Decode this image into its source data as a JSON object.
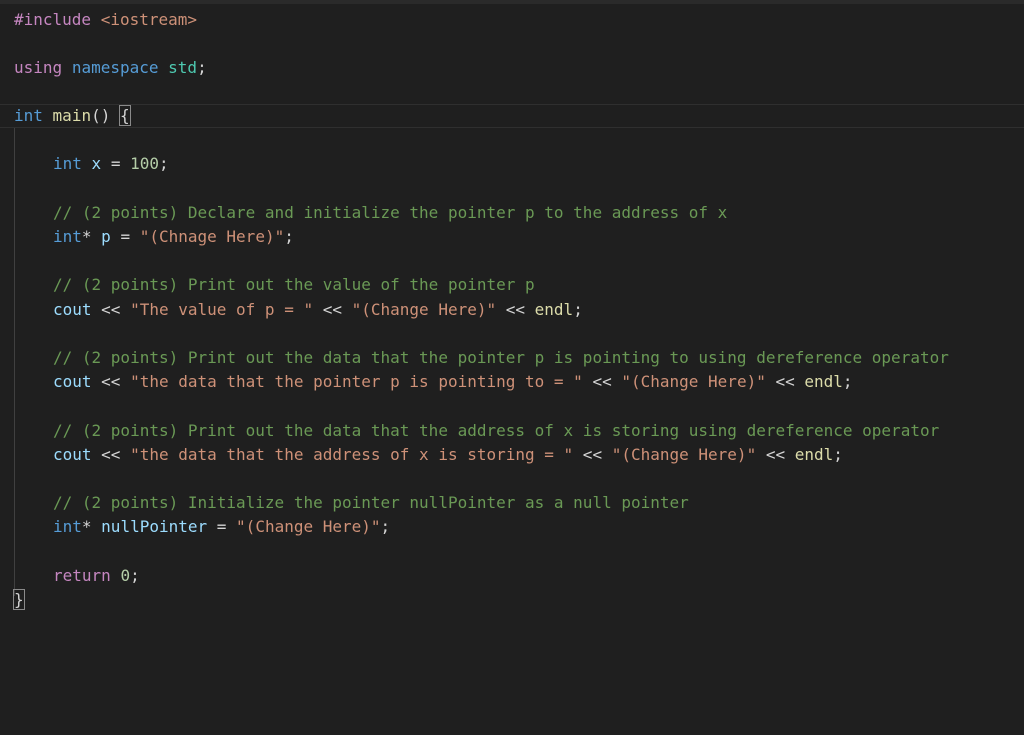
{
  "editor": {
    "lines": [
      {
        "tokens": [
          {
            "t": "#include",
            "c": "pp"
          },
          {
            "t": " ",
            "c": "plain"
          },
          {
            "t": "<iostream>",
            "c": "inc"
          }
        ]
      },
      {
        "tokens": [
          {
            "t": "using",
            "c": "ctl"
          },
          {
            "t": " ",
            "c": "plain"
          },
          {
            "t": "namespace",
            "c": "kw"
          },
          {
            "t": " ",
            "c": "plain"
          },
          {
            "t": "std",
            "c": "ns"
          },
          {
            "t": ";",
            "c": "plain"
          }
        ]
      },
      {
        "tokens": [
          {
            "t": "int",
            "c": "kw"
          },
          {
            "t": " ",
            "c": "plain"
          },
          {
            "t": "main",
            "c": "fn"
          },
          {
            "t": "() ",
            "c": "plain"
          },
          {
            "t": "{",
            "c": "plain"
          }
        ]
      },
      {
        "tokens": [
          {
            "t": "int",
            "c": "kw"
          },
          {
            "t": " ",
            "c": "plain"
          },
          {
            "t": "x",
            "c": "var"
          },
          {
            "t": " = ",
            "c": "plain"
          },
          {
            "t": "100",
            "c": "num"
          },
          {
            "t": ";",
            "c": "plain"
          }
        ]
      },
      {
        "tokens": [
          {
            "t": "// (2 points) Declare and initialize the pointer p to the address of x",
            "c": "cmt"
          }
        ]
      },
      {
        "tokens": [
          {
            "t": "int",
            "c": "kw"
          },
          {
            "t": "* ",
            "c": "plain"
          },
          {
            "t": "p",
            "c": "var"
          },
          {
            "t": " = ",
            "c": "plain"
          },
          {
            "t": "\"(Chnage Here)\"",
            "c": "str"
          },
          {
            "t": ";",
            "c": "plain"
          }
        ]
      },
      {
        "tokens": [
          {
            "t": "// (2 points) Print out the value of the pointer p",
            "c": "cmt"
          }
        ]
      },
      {
        "tokens": [
          {
            "t": "cout",
            "c": "var"
          },
          {
            "t": " << ",
            "c": "plain"
          },
          {
            "t": "\"The value of p = \"",
            "c": "str"
          },
          {
            "t": " << ",
            "c": "plain"
          },
          {
            "t": "\"(Change Here)\"",
            "c": "str"
          },
          {
            "t": " << ",
            "c": "plain"
          },
          {
            "t": "endl",
            "c": "fn"
          },
          {
            "t": ";",
            "c": "plain"
          }
        ]
      },
      {
        "tokens": [
          {
            "t": "// (2 points) Print out the data that the pointer p is pointing to using dereference operator",
            "c": "cmt"
          }
        ]
      },
      {
        "tokens": [
          {
            "t": "cout",
            "c": "var"
          },
          {
            "t": " << ",
            "c": "plain"
          },
          {
            "t": "\"the data that the pointer p is pointing to = \"",
            "c": "str"
          },
          {
            "t": " << ",
            "c": "plain"
          },
          {
            "t": "\"(Change Here)\"",
            "c": "str"
          },
          {
            "t": " << ",
            "c": "plain"
          },
          {
            "t": "endl",
            "c": "fn"
          },
          {
            "t": ";",
            "c": "plain"
          }
        ]
      },
      {
        "tokens": [
          {
            "t": "// (2 points) Print out the data that the address of x is storing using dereference operator",
            "c": "cmt"
          }
        ]
      },
      {
        "tokens": [
          {
            "t": "cout",
            "c": "var"
          },
          {
            "t": " << ",
            "c": "plain"
          },
          {
            "t": "\"the data that the address of x is storing = \"",
            "c": "str"
          },
          {
            "t": " << ",
            "c": "plain"
          },
          {
            "t": "\"(Change Here)\"",
            "c": "str"
          },
          {
            "t": " << ",
            "c": "plain"
          },
          {
            "t": "endl",
            "c": "fn"
          },
          {
            "t": ";",
            "c": "plain"
          }
        ]
      },
      {
        "tokens": [
          {
            "t": "// (2 points) Initialize the pointer nullPointer as a null pointer",
            "c": "cmt"
          }
        ]
      },
      {
        "tokens": [
          {
            "t": "int",
            "c": "kw"
          },
          {
            "t": "* ",
            "c": "plain"
          },
          {
            "t": "nullPointer",
            "c": "var"
          },
          {
            "t": " = ",
            "c": "plain"
          },
          {
            "t": "\"(Change Here)\"",
            "c": "str"
          },
          {
            "t": ";",
            "c": "plain"
          }
        ]
      },
      {
        "tokens": [
          {
            "t": "return",
            "c": "ctl"
          },
          {
            "t": " ",
            "c": "plain"
          },
          {
            "t": "0",
            "c": "num"
          },
          {
            "t": ";",
            "c": "plain"
          }
        ]
      },
      {
        "tokens": [
          {
            "t": "}",
            "c": "plain"
          }
        ]
      }
    ]
  },
  "colors": {
    "background": "#1f1f1f",
    "keyword": "#569cd6",
    "control": "#c586c0",
    "function": "#dcdcaa",
    "string": "#ce9178",
    "number": "#b5cea8",
    "comment": "#6a9955",
    "variable": "#9cdcfe",
    "namespace": "#4ec9b0"
  }
}
